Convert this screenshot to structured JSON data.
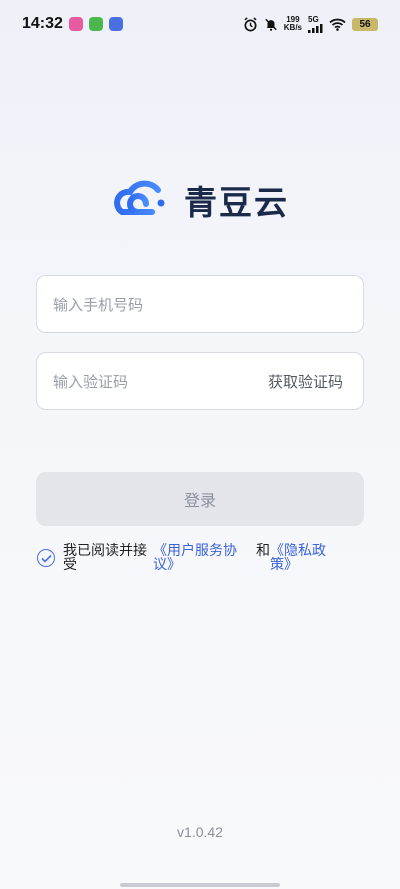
{
  "status_bar": {
    "time": "14:32",
    "net_speed_value": "199",
    "net_speed_unit": "KB/s",
    "network": "5G",
    "battery": "56"
  },
  "logo": {
    "text": "青豆云"
  },
  "phone_input": {
    "placeholder": "输入手机号码"
  },
  "code_input": {
    "placeholder": "输入验证码",
    "get_code_label": "获取验证码"
  },
  "login_button": {
    "label": "登录"
  },
  "agreement": {
    "prefix_line1": "我已阅读并接",
    "prefix_line2": "受",
    "user_agreement_line1": "《用户服务协",
    "user_agreement_line2": "议》",
    "and": "和",
    "privacy_line1": "《隐私政",
    "privacy_line2": "策》",
    "checked": true
  },
  "version": "v1.0.42",
  "colors": {
    "accent": "#3a63d8",
    "logo_blue": "#2f6cf0",
    "logo_text": "#1b2a4a"
  }
}
